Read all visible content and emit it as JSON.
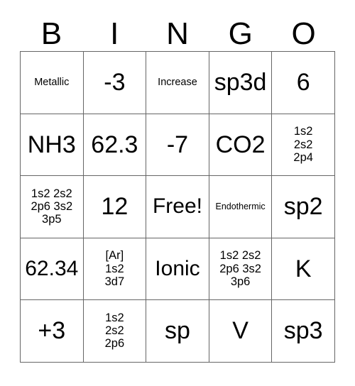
{
  "card": {
    "headers": [
      "B",
      "I",
      "N",
      "G",
      "O"
    ],
    "rows": [
      [
        {
          "text": "Metallic",
          "size": "fs-sm"
        },
        {
          "text": "-3",
          "size": "fs-xxl"
        },
        {
          "text": "Increase",
          "size": "fs-sm"
        },
        {
          "text": "sp3d",
          "size": "fs-xxl"
        },
        {
          "text": "6",
          "size": "fs-xxl"
        }
      ],
      [
        {
          "text": "NH3",
          "size": "fs-xxl"
        },
        {
          "text": "62.3",
          "size": "fs-xxl"
        },
        {
          "text": "-7",
          "size": "fs-xxl"
        },
        {
          "text": "CO2",
          "size": "fs-xxl"
        },
        {
          "text": "1s2\n2s2\n2p4",
          "size": "fs-md"
        }
      ],
      [
        {
          "text": "1s2 2s2 2p6 3s2 3p5",
          "size": "fs-md"
        },
        {
          "text": "12",
          "size": "fs-xxl"
        },
        {
          "text": "Free!",
          "size": "fs-xl"
        },
        {
          "text": "Endothermic",
          "size": "fs-xs"
        },
        {
          "text": "sp2",
          "size": "fs-xxl"
        }
      ],
      [
        {
          "text": "62.34",
          "size": "fs-xl"
        },
        {
          "text": "[Ar]\n1s2\n3d7",
          "size": "fs-md"
        },
        {
          "text": "Ionic",
          "size": "fs-xl"
        },
        {
          "text": "1s2 2s2 2p6 3s2 3p6",
          "size": "fs-md"
        },
        {
          "text": "K",
          "size": "fs-xxl"
        }
      ],
      [
        {
          "text": "+3",
          "size": "fs-xxl"
        },
        {
          "text": "1s2\n2s2\n2p6",
          "size": "fs-md"
        },
        {
          "text": "sp",
          "size": "fs-xxl"
        },
        {
          "text": "V",
          "size": "fs-xxl"
        },
        {
          "text": "sp3",
          "size": "fs-xxl"
        }
      ]
    ],
    "free_space": {
      "row": 2,
      "col": 2
    },
    "colors": {
      "background": "#ffffff",
      "text": "#000000",
      "border": "#666666"
    }
  }
}
